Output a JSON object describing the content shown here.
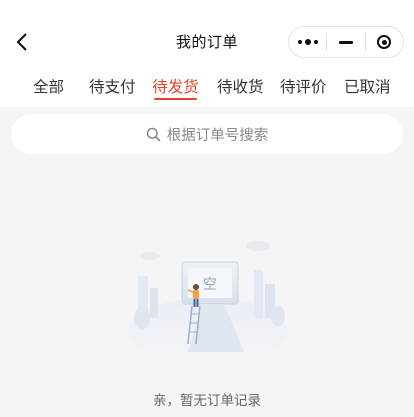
{
  "nav": {
    "title": "我的订单",
    "back_icon": "chevron-left-icon",
    "capsule": [
      "more-dots-icon",
      "minimize-icon",
      "target-icon"
    ]
  },
  "tabs": [
    {
      "label": "全部",
      "active": false
    },
    {
      "label": "待支付",
      "active": false
    },
    {
      "label": "待发货",
      "active": true
    },
    {
      "label": "待收货",
      "active": false
    },
    {
      "label": "待评价",
      "active": false
    },
    {
      "label": "已取消",
      "active": false
    }
  ],
  "search": {
    "placeholder": "根据订单号搜索",
    "icon": "search-icon"
  },
  "empty": {
    "sign_text": "空",
    "message": "亲，暂无订单记录"
  },
  "colors": {
    "accent": "#e5452e",
    "background": "#f5f5f5"
  }
}
